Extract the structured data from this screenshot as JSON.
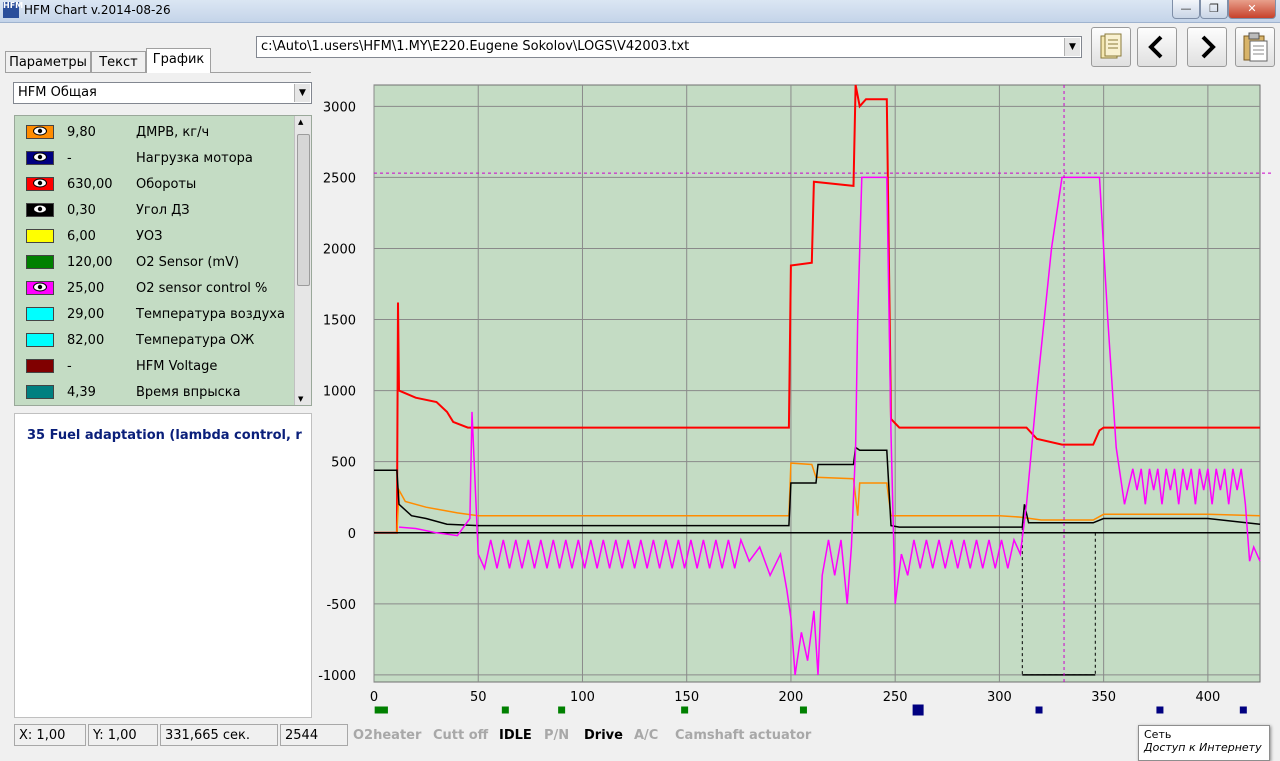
{
  "window": {
    "title": "HFM Chart   v.2014-08-26",
    "icon_text": "HFM"
  },
  "tabs": [
    {
      "label": "Параметры",
      "active": false
    },
    {
      "label": "Текст",
      "active": false
    },
    {
      "label": "График",
      "active": true
    }
  ],
  "preset_select": {
    "value": "HFM Общая"
  },
  "file_path": {
    "value": "c:\\Auto\\1.users\\HFM\\1.MY\\E220.Eugene Sokolov\\LOGS\\V42003.txt"
  },
  "toolbar": {
    "open_icon": "open-file-icon",
    "prev_icon": "arrow-left-icon",
    "next_icon": "arrow-right-icon",
    "paste_icon": "clipboard-icon"
  },
  "params": [
    {
      "value": "9,80",
      "name": "ДМРВ, кг/ч",
      "color": "#ff8c00",
      "eye": true
    },
    {
      "value": "-",
      "name": "Нагрузка мотора",
      "color": "#000080",
      "eye": true
    },
    {
      "value": "630,00",
      "name": "Обороты",
      "color": "#ff0000",
      "eye": true
    },
    {
      "value": "0,30",
      "name": "Угол ДЗ",
      "color": "#000000",
      "eye": true
    },
    {
      "value": "6,00",
      "name": "УОЗ",
      "color": "#ffff00",
      "eye": false
    },
    {
      "value": "120,00",
      "name": "O2 Sensor (mV)",
      "color": "#008000",
      "eye": false
    },
    {
      "value": "25,00",
      "name": "O2 sensor control %",
      "color": "#ff00ff",
      "eye": true
    },
    {
      "value": "29,00",
      "name": "Температура воздуха",
      "color": "#00ffff",
      "eye": false
    },
    {
      "value": "82,00",
      "name": "Температура ОЖ",
      "color": "#00ffff",
      "eye": false
    },
    {
      "value": "-",
      "name": "HFM Voltage",
      "color": "#800000",
      "eye": false
    },
    {
      "value": "4,39",
      "name": "Время впрыска",
      "color": "#008080",
      "eye": false
    }
  ],
  "info": {
    "line": "35   Fuel adaptation (lambda control, r"
  },
  "status": {
    "x": "X: 1,00",
    "y": "Y: 1,00",
    "time": "331,665 сек.",
    "sample": "2544",
    "flags": [
      {
        "label": "O2heater",
        "on": false
      },
      {
        "label": "Cutt off",
        "on": false
      },
      {
        "label": "IDLE",
        "on": true
      },
      {
        "label": "P/N",
        "on": false
      },
      {
        "label": "Drive",
        "on": true
      },
      {
        "label": "A/C",
        "on": false
      },
      {
        "label": "Camshaft actuator",
        "on": false
      }
    ]
  },
  "tooltip": {
    "title": "Сеть",
    "text": "Доступ к Интернету"
  },
  "chart_data": {
    "type": "line",
    "xlim": [
      0,
      425
    ],
    "ylim": [
      -1050,
      3150
    ],
    "x_ticks": [
      0,
      50,
      100,
      150,
      200,
      250,
      300,
      350,
      400
    ],
    "y_ticks": [
      -1000,
      -500,
      0,
      500,
      1000,
      1500,
      2000,
      2500,
      3000
    ],
    "grid": true,
    "background": "#c4dcc4",
    "cursor": {
      "x": 331,
      "y": 2530
    },
    "series": [
      {
        "color": "#ff0000",
        "points": [
          [
            0,
            0
          ],
          [
            11,
            0
          ],
          [
            11.5,
            1620
          ],
          [
            12,
            1000
          ],
          [
            20,
            950
          ],
          [
            30,
            920
          ],
          [
            35,
            850
          ],
          [
            38,
            780
          ],
          [
            45,
            740
          ],
          [
            100,
            740
          ],
          [
            150,
            740
          ],
          [
            199,
            740
          ],
          [
            200,
            1880
          ],
          [
            210,
            1900
          ],
          [
            211,
            2470
          ],
          [
            230,
            2440
          ],
          [
            231,
            3150
          ],
          [
            233,
            3000
          ],
          [
            236,
            3050
          ],
          [
            246,
            3050
          ],
          [
            248,
            800
          ],
          [
            252,
            740
          ],
          [
            300,
            740
          ],
          [
            313,
            740
          ],
          [
            318,
            660
          ],
          [
            330,
            620
          ],
          [
            345,
            620
          ],
          [
            348,
            720
          ],
          [
            350,
            740
          ],
          [
            400,
            740
          ],
          [
            425,
            740
          ]
        ]
      },
      {
        "color": "#ff8c00",
        "points": [
          [
            0,
            0
          ],
          [
            11,
            0
          ],
          [
            12,
            300
          ],
          [
            15,
            220
          ],
          [
            25,
            180
          ],
          [
            40,
            140
          ],
          [
            50,
            120
          ],
          [
            100,
            120
          ],
          [
            150,
            120
          ],
          [
            199,
            120
          ],
          [
            200,
            490
          ],
          [
            210,
            480
          ],
          [
            212,
            390
          ],
          [
            230,
            380
          ],
          [
            232,
            120
          ],
          [
            233,
            350
          ],
          [
            246,
            350
          ],
          [
            248,
            120
          ],
          [
            300,
            120
          ],
          [
            310,
            110
          ],
          [
            320,
            90
          ],
          [
            345,
            90
          ],
          [
            350,
            130
          ],
          [
            400,
            130
          ],
          [
            425,
            120
          ]
        ]
      },
      {
        "color": "#000000",
        "points": [
          [
            0,
            440
          ],
          [
            11,
            440
          ],
          [
            12,
            200
          ],
          [
            18,
            120
          ],
          [
            25,
            100
          ],
          [
            35,
            60
          ],
          [
            50,
            50
          ],
          [
            100,
            50
          ],
          [
            150,
            50
          ],
          [
            199,
            50
          ],
          [
            200,
            350
          ],
          [
            212,
            350
          ],
          [
            213,
            480
          ],
          [
            221,
            480
          ],
          [
            222,
            480
          ],
          [
            230,
            480
          ],
          [
            231,
            600
          ],
          [
            233,
            580
          ],
          [
            246,
            580
          ],
          [
            248,
            50
          ],
          [
            252,
            40
          ],
          [
            311,
            40
          ],
          [
            312,
            200
          ],
          [
            314,
            70
          ],
          [
            345,
            70
          ],
          [
            350,
            100
          ],
          [
            400,
            100
          ],
          [
            425,
            60
          ]
        ]
      },
      {
        "color": "#000000",
        "dashed": true,
        "points": [
          [
            311,
            40
          ],
          [
            311,
            -1000
          ],
          [
            346,
            -1000
          ],
          [
            346,
            0
          ]
        ]
      },
      {
        "color": "#000000",
        "points": [
          [
            311,
            -1000
          ],
          [
            346,
            -1000
          ]
        ]
      },
      {
        "color": "#000000",
        "points": [
          [
            0,
            0
          ],
          [
            425,
            0
          ]
        ]
      },
      {
        "color": "#ff00ff",
        "points": [
          [
            12,
            40
          ],
          [
            20,
            30
          ],
          [
            30,
            0
          ],
          [
            40,
            -20
          ],
          [
            46,
            100
          ],
          [
            47,
            850
          ],
          [
            50,
            -150
          ],
          [
            53,
            -250
          ],
          [
            56,
            -50
          ],
          [
            59,
            -250
          ],
          [
            62,
            -50
          ],
          [
            65,
            -250
          ],
          [
            68,
            -50
          ],
          [
            71,
            -250
          ],
          [
            74,
            -50
          ],
          [
            77,
            -250
          ],
          [
            80,
            -50
          ],
          [
            83,
            -250
          ],
          [
            86,
            -50
          ],
          [
            89,
            -250
          ],
          [
            92,
            -50
          ],
          [
            95,
            -250
          ],
          [
            98,
            -50
          ],
          [
            101,
            -250
          ],
          [
            104,
            -50
          ],
          [
            107,
            -250
          ],
          [
            110,
            -50
          ],
          [
            113,
            -250
          ],
          [
            116,
            -50
          ],
          [
            119,
            -250
          ],
          [
            122,
            -50
          ],
          [
            125,
            -250
          ],
          [
            128,
            -50
          ],
          [
            131,
            -250
          ],
          [
            134,
            -50
          ],
          [
            137,
            -250
          ],
          [
            140,
            -50
          ],
          [
            143,
            -250
          ],
          [
            146,
            -50
          ],
          [
            149,
            -250
          ],
          [
            152,
            -50
          ],
          [
            155,
            -250
          ],
          [
            158,
            -50
          ],
          [
            161,
            -250
          ],
          [
            164,
            -50
          ],
          [
            167,
            -250
          ],
          [
            170,
            -50
          ],
          [
            173,
            -250
          ],
          [
            176,
            -50
          ],
          [
            180,
            -200
          ],
          [
            185,
            -100
          ],
          [
            190,
            -300
          ],
          [
            195,
            -150
          ],
          [
            198,
            -400
          ],
          [
            200,
            -600
          ],
          [
            202,
            -1000
          ],
          [
            205,
            -700
          ],
          [
            208,
            -900
          ],
          [
            211,
            -550
          ],
          [
            213,
            -1000
          ],
          [
            215,
            -300
          ],
          [
            218,
            -50
          ],
          [
            221,
            -300
          ],
          [
            224,
            -50
          ],
          [
            227,
            -500
          ],
          [
            229,
            -100
          ],
          [
            231,
            600
          ],
          [
            232,
            1500
          ],
          [
            234,
            2500
          ],
          [
            246,
            2500
          ],
          [
            248,
            700
          ],
          [
            250,
            -500
          ],
          [
            253,
            -150
          ],
          [
            256,
            -300
          ],
          [
            259,
            -50
          ],
          [
            262,
            -250
          ],
          [
            265,
            -50
          ],
          [
            268,
            -250
          ],
          [
            271,
            -50
          ],
          [
            274,
            -250
          ],
          [
            277,
            -50
          ],
          [
            280,
            -250
          ],
          [
            283,
            -50
          ],
          [
            286,
            -250
          ],
          [
            289,
            -50
          ],
          [
            292,
            -250
          ],
          [
            295,
            -50
          ],
          [
            298,
            -250
          ],
          [
            301,
            -50
          ],
          [
            304,
            -250
          ],
          [
            307,
            -50
          ],
          [
            310,
            -150
          ],
          [
            313,
            200
          ],
          [
            318,
            1000
          ],
          [
            325,
            2000
          ],
          [
            330,
            2500
          ],
          [
            348,
            2500
          ],
          [
            352,
            1500
          ],
          [
            356,
            600
          ],
          [
            360,
            200
          ],
          [
            364,
            450
          ],
          [
            366,
            300
          ],
          [
            368,
            450
          ],
          [
            370,
            200
          ],
          [
            372,
            450
          ],
          [
            374,
            300
          ],
          [
            376,
            450
          ],
          [
            378,
            200
          ],
          [
            380,
            450
          ],
          [
            382,
            300
          ],
          [
            384,
            450
          ],
          [
            386,
            200
          ],
          [
            388,
            450
          ],
          [
            390,
            300
          ],
          [
            392,
            450
          ],
          [
            394,
            200
          ],
          [
            396,
            450
          ],
          [
            398,
            300
          ],
          [
            400,
            450
          ],
          [
            402,
            200
          ],
          [
            404,
            450
          ],
          [
            406,
            300
          ],
          [
            408,
            450
          ],
          [
            410,
            200
          ],
          [
            412,
            450
          ],
          [
            414,
            300
          ],
          [
            416,
            450
          ],
          [
            418,
            200
          ],
          [
            420,
            -200
          ],
          [
            422,
            -100
          ],
          [
            425,
            -200
          ]
        ]
      }
    ],
    "bottom_markers": [
      {
        "x": 2,
        "color": "#008000"
      },
      {
        "x": 5,
        "color": "#008000"
      },
      {
        "x": 63,
        "color": "#008000"
      },
      {
        "x": 90,
        "color": "#008000"
      },
      {
        "x": 149,
        "color": "#008000"
      },
      {
        "x": 206,
        "color": "#008000"
      },
      {
        "x": 261,
        "color": "#000080",
        "big": true
      },
      {
        "x": 319,
        "color": "#000080"
      },
      {
        "x": 377,
        "color": "#000080"
      },
      {
        "x": 417,
        "color": "#000080"
      }
    ]
  }
}
